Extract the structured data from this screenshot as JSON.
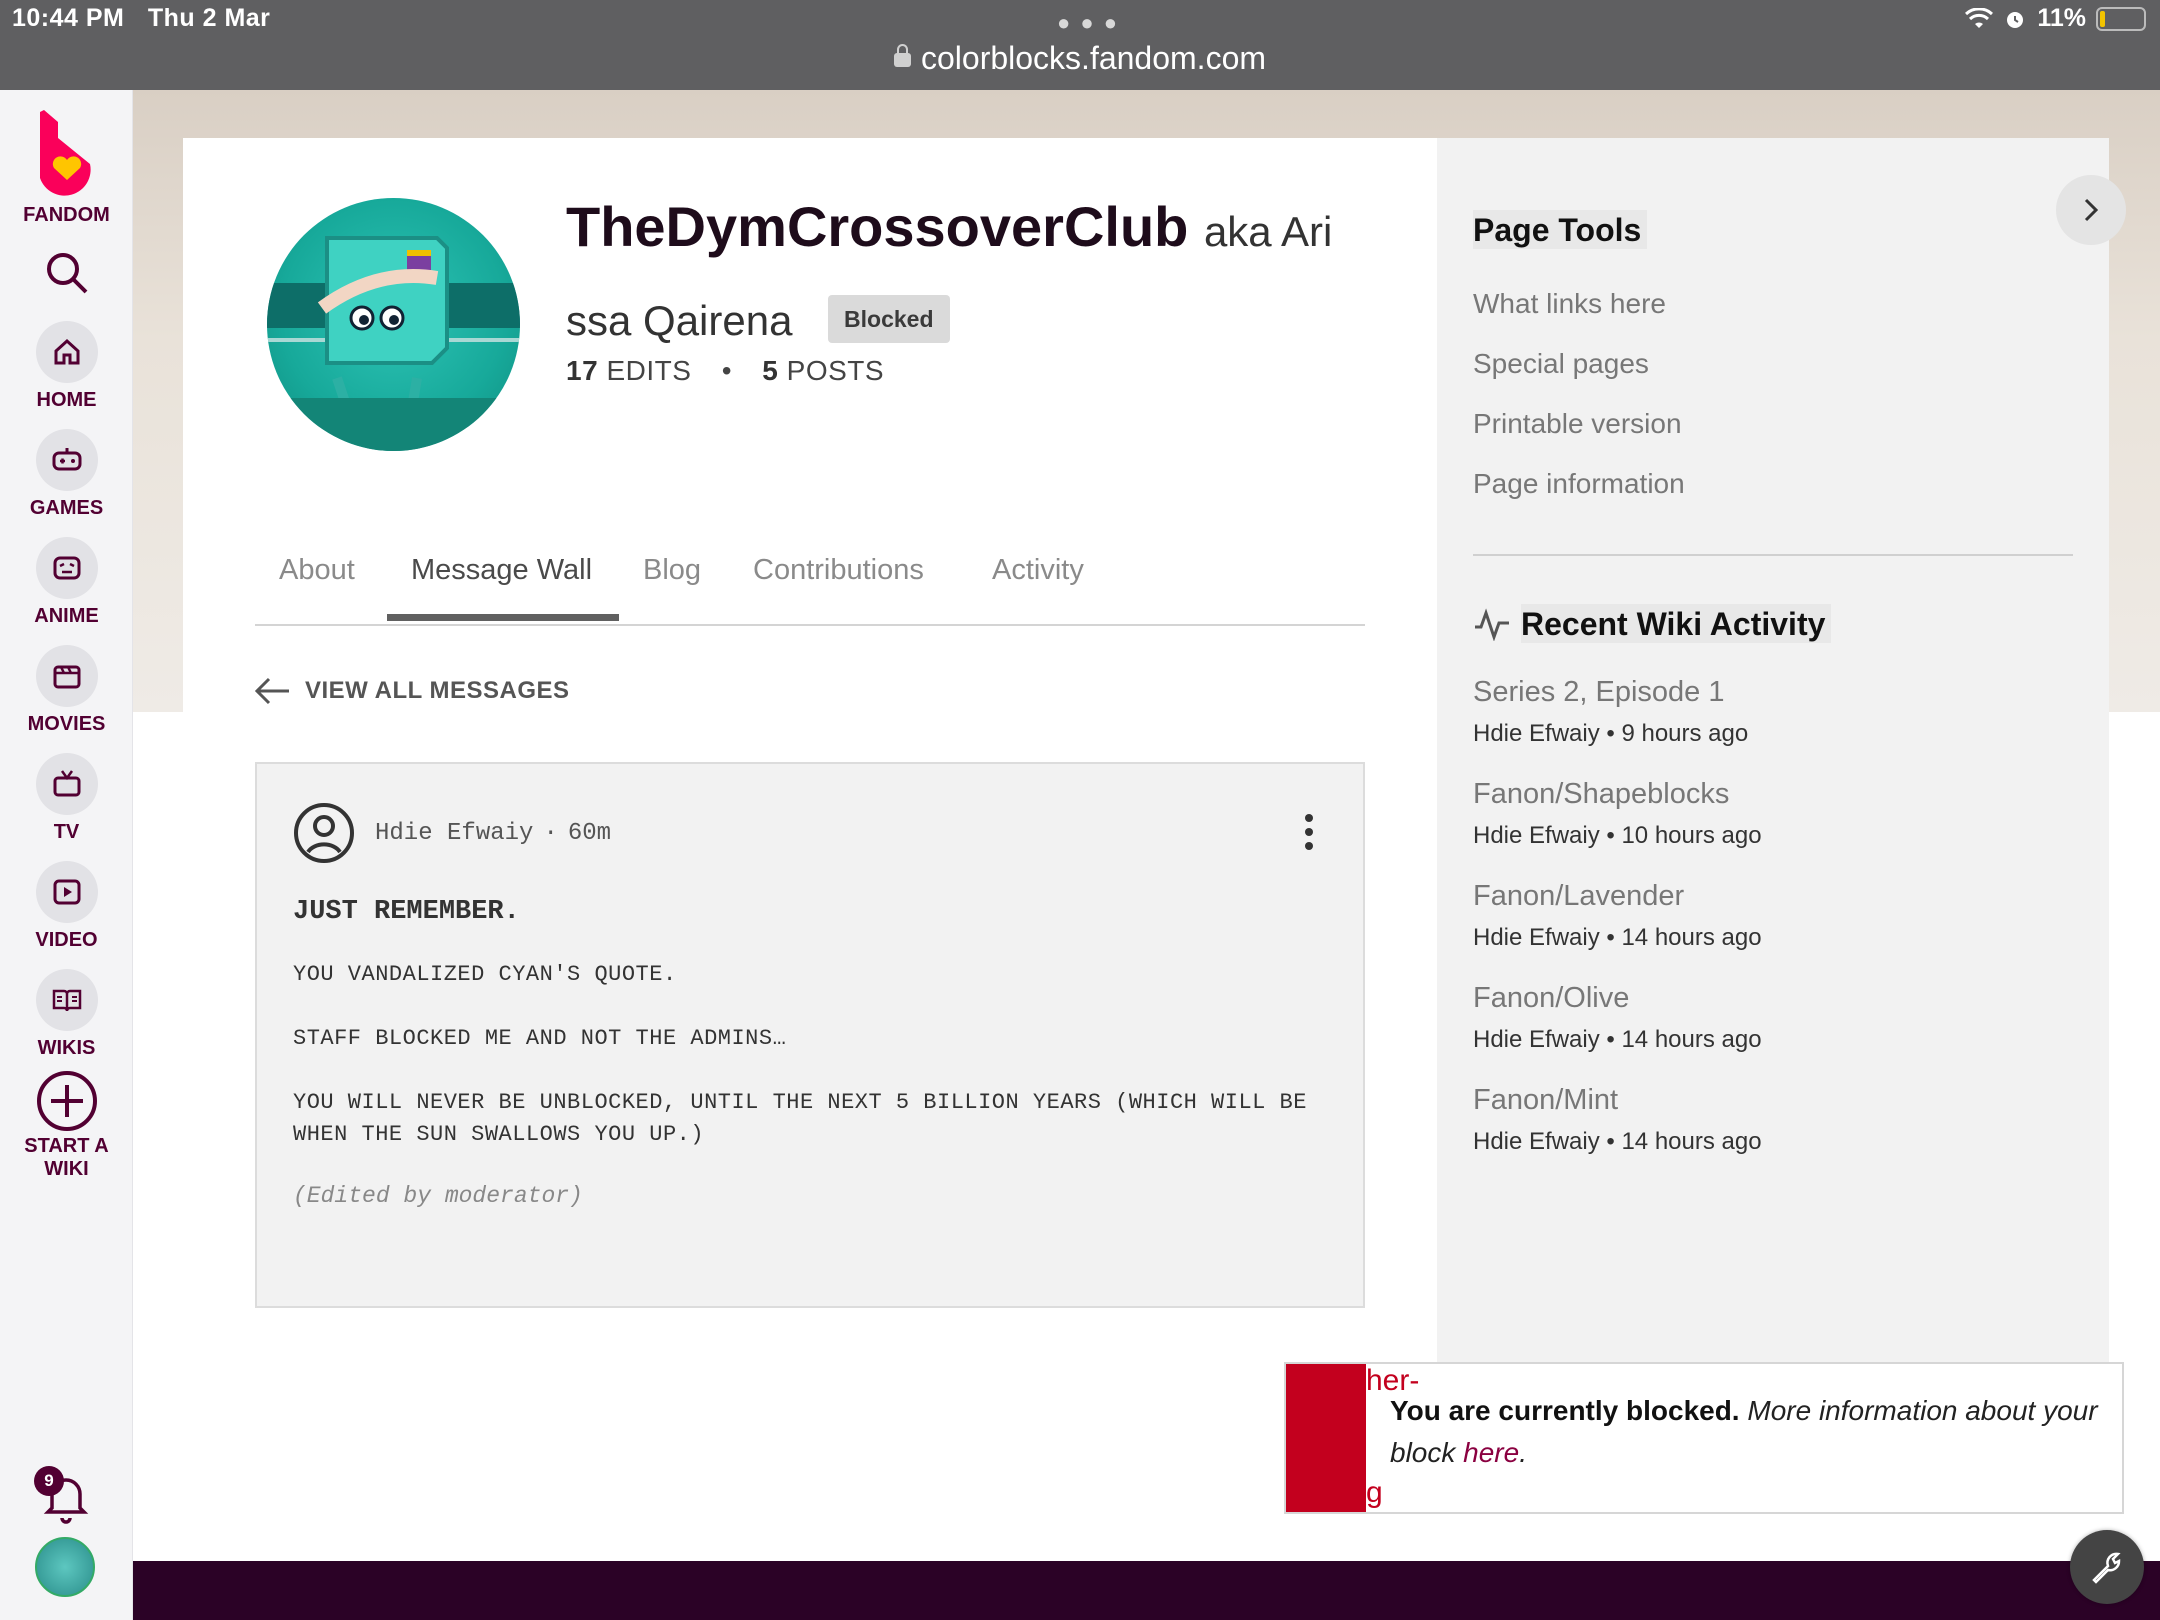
{
  "status": {
    "time": "10:44 PM",
    "date": "Thu 2 Mar",
    "battery": "11%"
  },
  "browser": {
    "url": "colorblocks.fandom.com"
  },
  "nav": {
    "logo_label": "FANDOM",
    "items": [
      {
        "label": "HOME",
        "icon": "home-icon"
      },
      {
        "label": "GAMES",
        "icon": "gamepad-icon"
      },
      {
        "label": "ANIME",
        "icon": "anime-icon"
      },
      {
        "label": "MOVIES",
        "icon": "clapperboard-icon"
      },
      {
        "label": "TV",
        "icon": "tv-icon"
      },
      {
        "label": "VIDEO",
        "icon": "play-icon"
      },
      {
        "label": "WIKIS",
        "icon": "book-icon"
      }
    ],
    "start_wiki_line1": "START A",
    "start_wiki_line2": "WIKI",
    "notifications_count": "9"
  },
  "profile": {
    "username": "TheDymCrossoverClub",
    "aka": "aka Arissa Qairena",
    "aka_part1": "aka Ari",
    "aka_part2": "ssa Qairena",
    "badge": "Blocked",
    "edits_count": "17",
    "edits_label": "EDITS",
    "posts_count": "5",
    "posts_label": "POSTS",
    "separator": "•"
  },
  "tabs": [
    "About",
    "Message Wall",
    "Blog",
    "Contributions",
    "Activity"
  ],
  "active_tab": "Message Wall",
  "view_all": "VIEW ALL MESSAGES",
  "message": {
    "author": "Hdie Efwaiy",
    "time": "60m",
    "title": "JUST REMEMBER.",
    "paragraphs": [
      "YOU VANDALIZED CYAN'S QUOTE.",
      "STAFF BLOCKED ME AND NOT THE ADMINS…",
      "YOU WILL NEVER BE UNBLOCKED, UNTIL THE NEXT 5 BILLION YEARS (WHICH WILL BE WHEN THE SUN SWALLOWS YOU UP.)"
    ],
    "edited": "(Edited by moderator)"
  },
  "rail": {
    "page_tools_title": "Page Tools",
    "tools": [
      "What links here",
      "Special pages",
      "Printable version",
      "Page information"
    ],
    "recent_title": "Recent Wiki Activity",
    "activity": [
      {
        "title": "Series 2, Episode 1",
        "meta": "Hdie Efwaiy • 9 hours ago"
      },
      {
        "title": "Fanon/Shapeblocks",
        "meta": "Hdie Efwaiy • 10 hours ago"
      },
      {
        "title": "Fanon/Lavender",
        "meta": "Hdie Efwaiy • 14 hours ago"
      },
      {
        "title": "Fanon/Olive",
        "meta": "Hdie Efwaiy • 14 hours ago"
      },
      {
        "title": "Fanon/Mint",
        "meta": "Hdie Efwaiy • 14 hours ago"
      }
    ]
  },
  "banner": {
    "peek_top": "her-",
    "peek_bottom": "g",
    "bold": "You are currently blocked.",
    "italic": "More information about your block",
    "link": "here",
    "end": "."
  },
  "colors": {
    "brand": "#520032",
    "fandom_pink": "#fa005a",
    "alert_red": "#c3001e"
  }
}
